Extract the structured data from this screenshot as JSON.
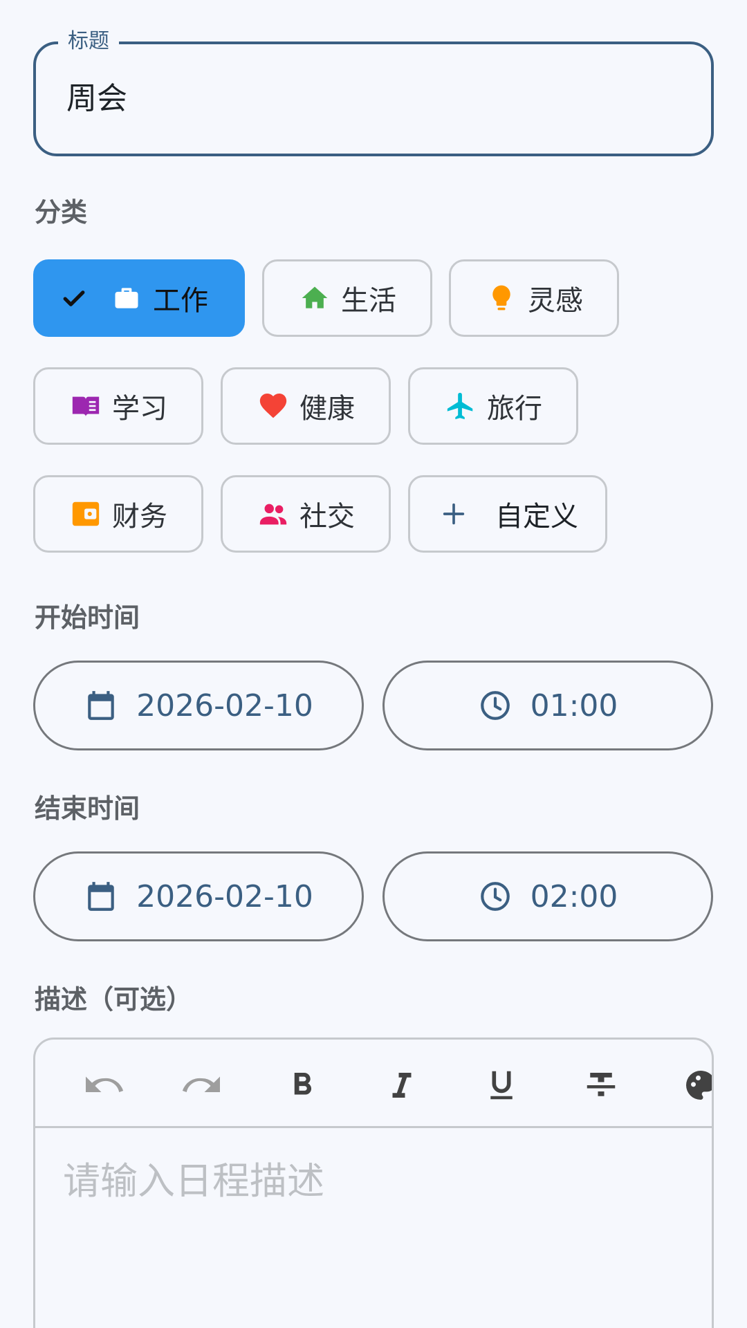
{
  "title_field": {
    "label": "标题",
    "value": "周会"
  },
  "category": {
    "label": "分类",
    "chips": [
      {
        "label": "工作",
        "selected": true,
        "icon": "briefcase-icon",
        "color": "#ffffff"
      },
      {
        "label": "生活",
        "selected": false,
        "icon": "home-icon",
        "color": "#4caf50"
      },
      {
        "label": "灵感",
        "selected": false,
        "icon": "lightbulb-icon",
        "color": "#ff9800"
      },
      {
        "label": "学习",
        "selected": false,
        "icon": "book-icon",
        "color": "#9c27b0"
      },
      {
        "label": "健康",
        "selected": false,
        "icon": "heart-icon",
        "color": "#f44336"
      },
      {
        "label": "旅行",
        "selected": false,
        "icon": "airplane-icon",
        "color": "#00bcd4"
      },
      {
        "label": "财务",
        "selected": false,
        "icon": "wallet-icon",
        "color": "#ff9800"
      },
      {
        "label": "社交",
        "selected": false,
        "icon": "people-icon",
        "color": "#e91e63"
      },
      {
        "label": "自定义",
        "selected": false,
        "icon": "plus-icon",
        "color": "#3b5f82"
      }
    ]
  },
  "start": {
    "label": "开始时间",
    "date": "2026-02-10",
    "time": "01:00"
  },
  "end": {
    "label": "结束时间",
    "date": "2026-02-10",
    "time": "02:00"
  },
  "description": {
    "label": "描述（可选）",
    "placeholder": "请输入日程描述",
    "toolbar": [
      "undo-icon",
      "redo-icon",
      "bold-icon",
      "italic-icon",
      "underline-icon",
      "strikethrough-icon",
      "color-palette-icon"
    ]
  },
  "colors": {
    "primary": "#3b5f82",
    "selected_chip": "#2f96ef",
    "background": "#f6f8fd"
  }
}
